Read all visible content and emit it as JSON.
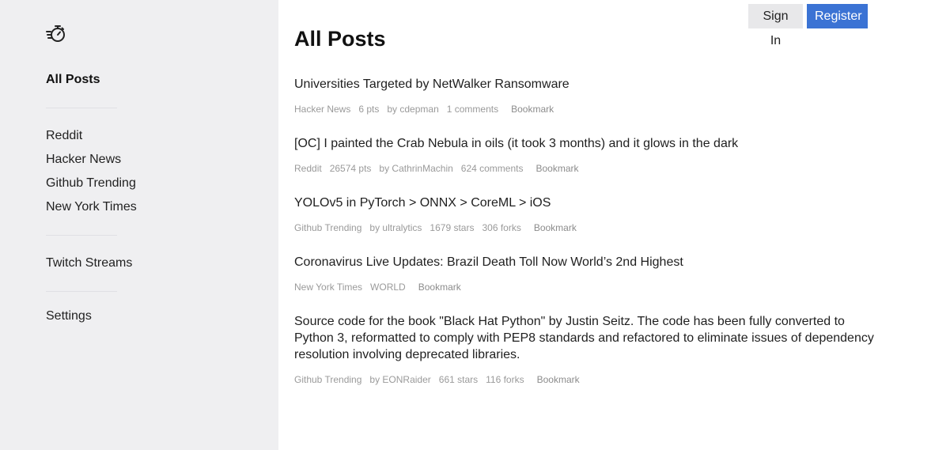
{
  "sidebar": {
    "logo_icon": "stopwatch-fast-icon",
    "items": [
      {
        "label": "All Posts"
      },
      {
        "label": "Reddit"
      },
      {
        "label": "Hacker News"
      },
      {
        "label": "Github Trending"
      },
      {
        "label": "New York Times"
      },
      {
        "label": "Twitch Streams"
      },
      {
        "label": "Settings"
      }
    ]
  },
  "header": {
    "signin_label": "Sign In",
    "register_label": "Register"
  },
  "main": {
    "title": "All Posts",
    "posts": [
      {
        "title": "Universities Targeted by NetWalker Ransomware",
        "source": "Hacker News",
        "m1": "6 pts",
        "m2": "by cdepman",
        "m3": "1 comments",
        "bookmark": "Bookmark"
      },
      {
        "title": "[OC] I painted the Crab Nebula in oils (it took 3 months) and it glows in the dark",
        "source": "Reddit",
        "m1": "26574 pts",
        "m2": "by CathrinMachin",
        "m3": "624 comments",
        "bookmark": "Bookmark"
      },
      {
        "title": "YOLOv5 in PyTorch > ONNX > CoreML > iOS",
        "source": "Github Trending",
        "m1": "by ultralytics",
        "m2": "1679 stars",
        "m3": "306 forks",
        "bookmark": "Bookmark"
      },
      {
        "title": "Coronavirus Live Updates: Brazil Death Toll Now World’s 2nd Highest",
        "source": "New York Times",
        "m1": "WORLD",
        "bookmark": "Bookmark"
      },
      {
        "title": "Source code for the book \"Black Hat Python\" by Justin Seitz. The code has been fully converted to Python 3, reformatted to comply with PEP8 standards and refactored to eliminate issues of dependency resolution involving deprecated libraries.",
        "source": "Github Trending",
        "m1": "by EONRaider",
        "m2": "661 stars",
        "m3": "116 forks",
        "bookmark": "Bookmark"
      }
    ]
  }
}
